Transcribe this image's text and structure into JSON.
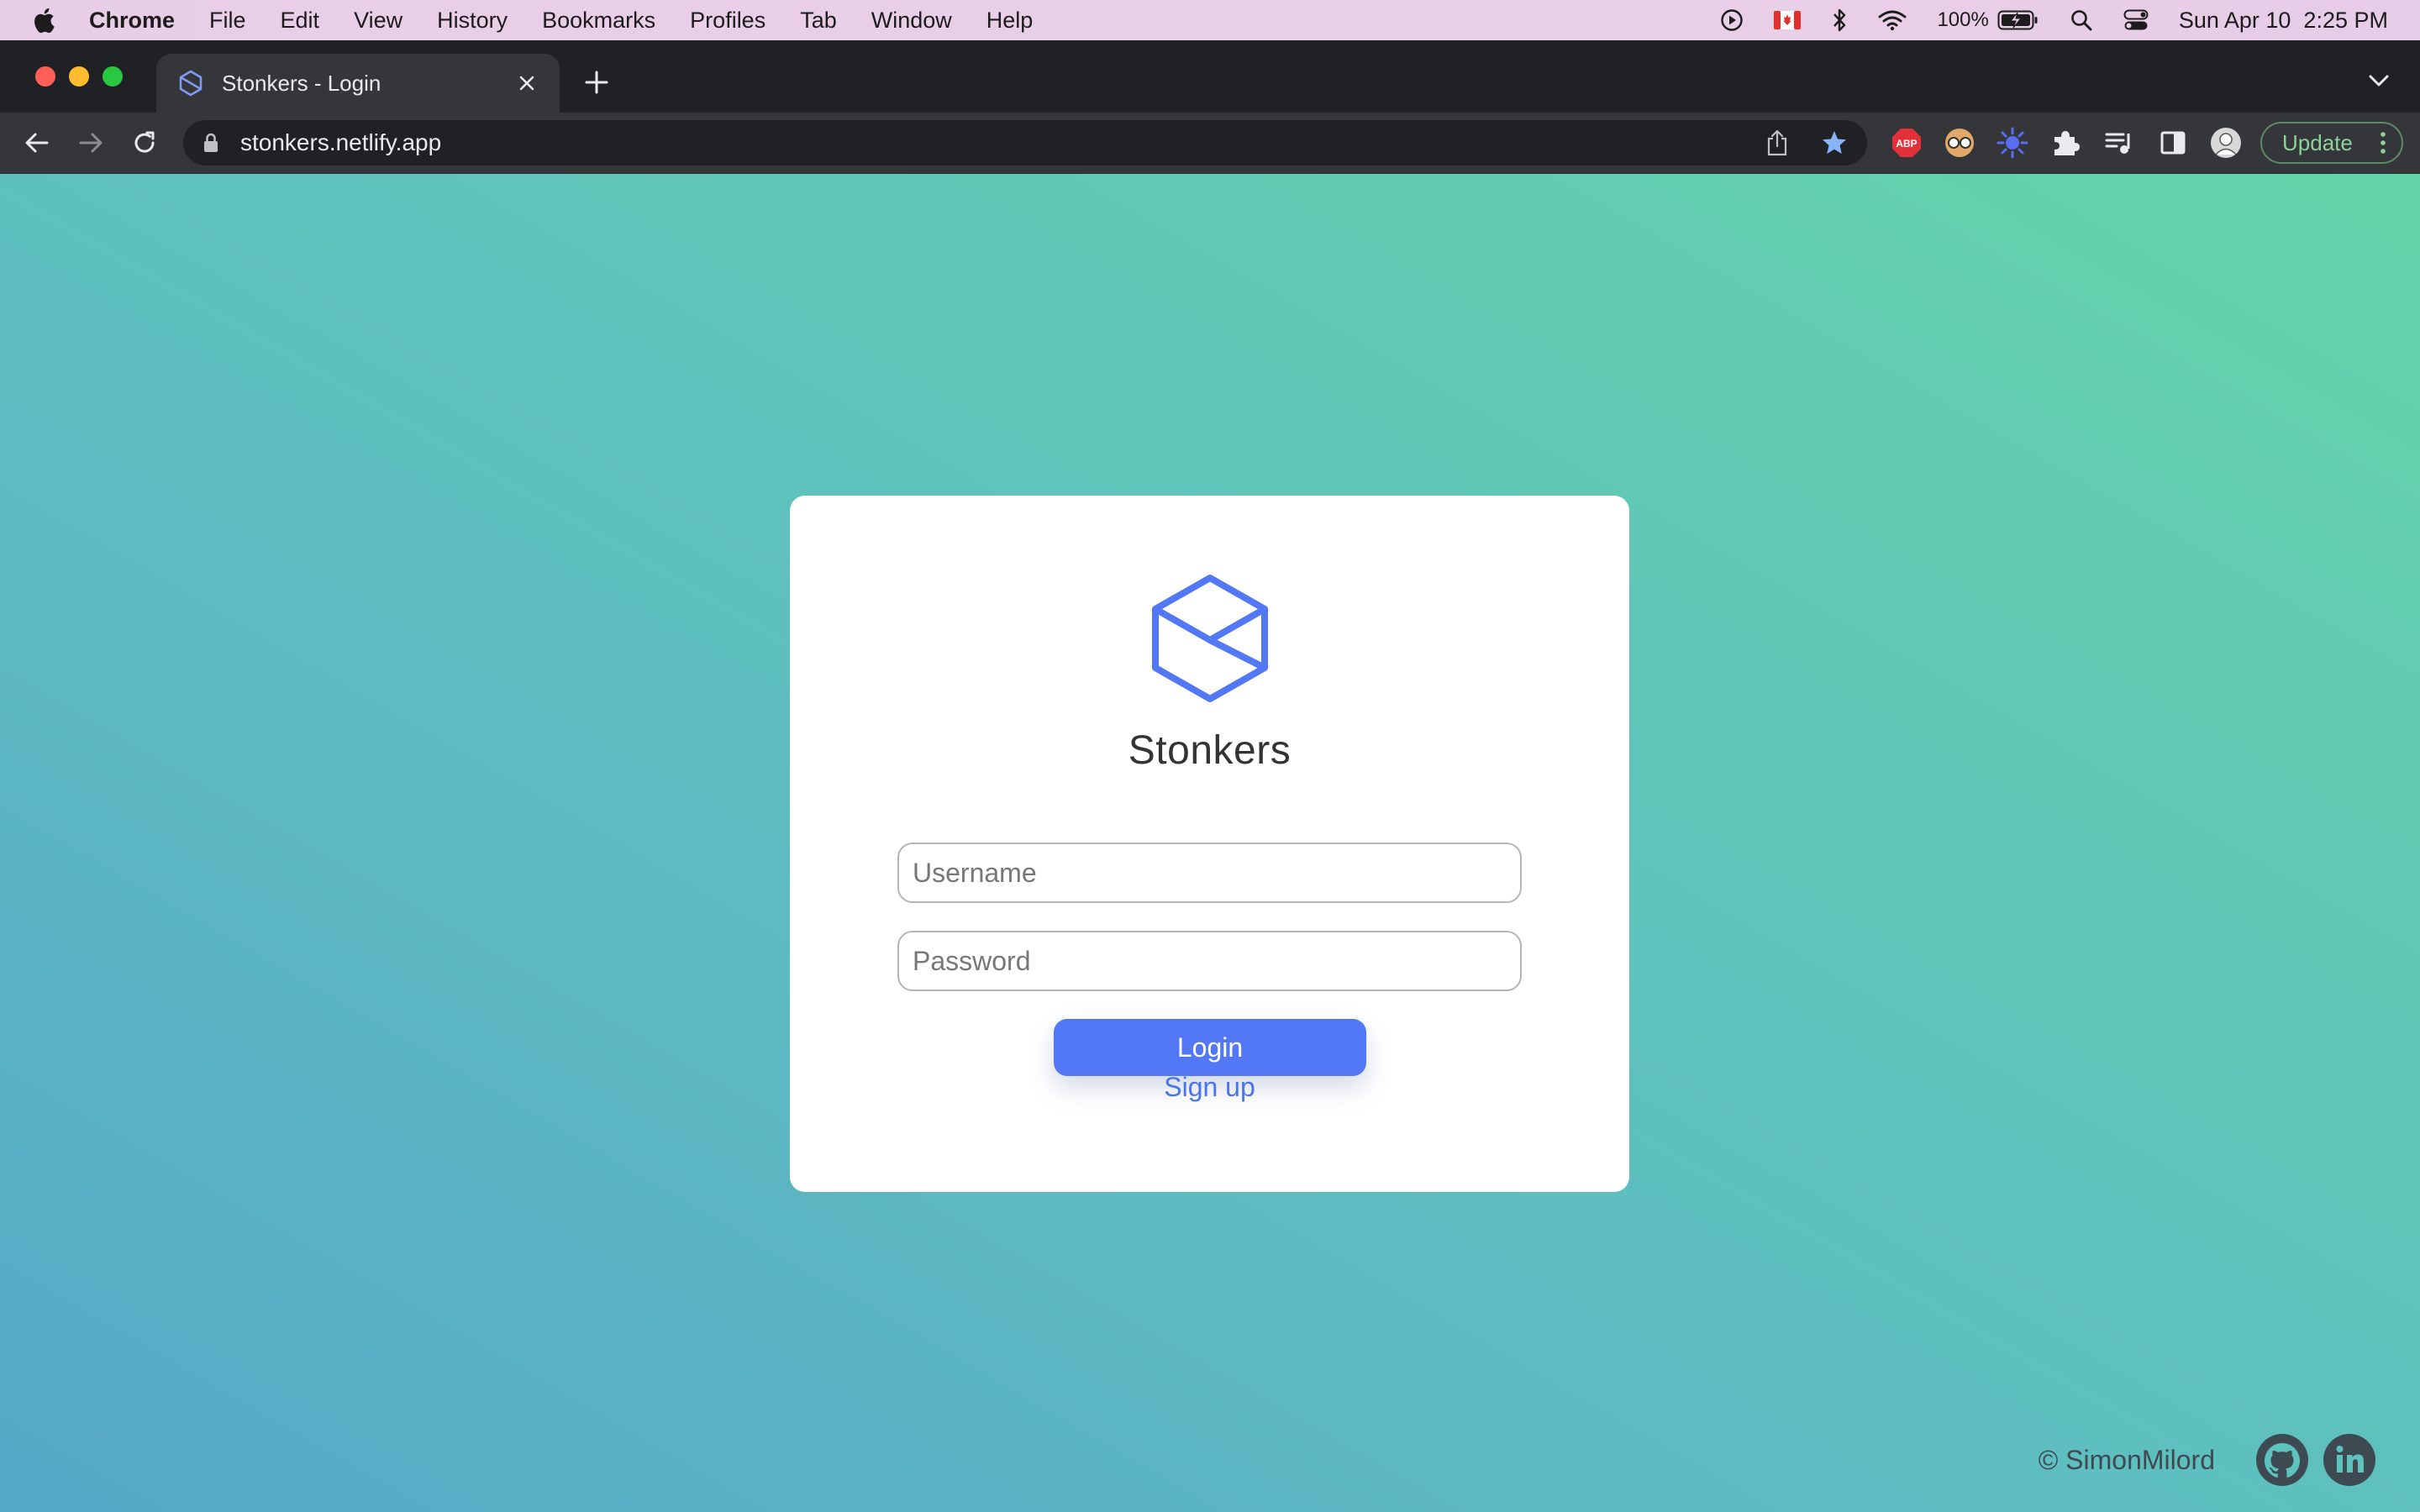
{
  "menubar": {
    "app_name": "Chrome",
    "items": [
      "File",
      "Edit",
      "View",
      "History",
      "Bookmarks",
      "Profiles",
      "Tab",
      "Window",
      "Help"
    ],
    "battery": "100%",
    "clock": "Sun Apr 10  2:25 PM"
  },
  "browser": {
    "tab_title": "Stonkers - Login",
    "url": "stonkers.netlify.app",
    "update_label": "Update",
    "extensions": [
      "adblock-plus-icon",
      "glasses-extension-icon",
      "sun-extension-icon",
      "puzzle-icon",
      "media-control-icon",
      "side-panel-icon",
      "profile-avatar-icon"
    ]
  },
  "login": {
    "brand": "Stonkers",
    "username_placeholder": "Username",
    "password_placeholder": "Password",
    "login_label": "Login",
    "signup_label": "Sign up"
  },
  "footer": {
    "copyright": "© SimonMilord"
  },
  "colors": {
    "accent": "#5378f5",
    "link": "#4a74ef",
    "background_start": "#56a9c7",
    "background_end": "#64d4a9"
  }
}
